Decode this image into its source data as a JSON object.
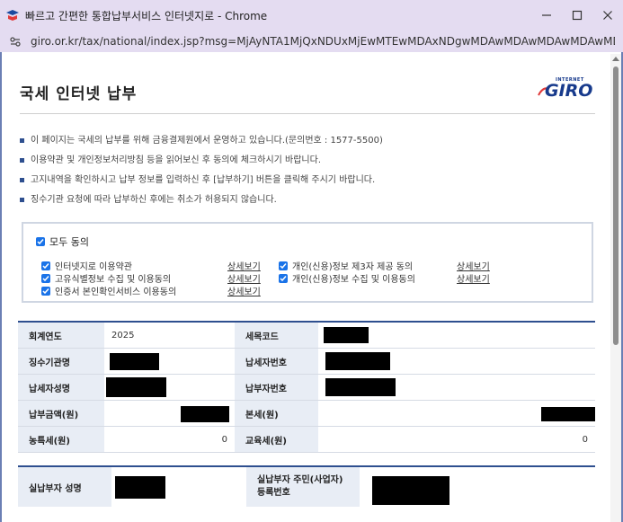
{
  "browser": {
    "title": "빠르고 간편한 통합납부서비스 인터넷지로 - Chrome",
    "url": "giro.or.kr/tax/national/index.jsp?msg=MjAyNTA1MjQxNDUxMjEwMTEwMDAxNDgwMDAwMDAwMDAwMDAwMDA..."
  },
  "page": {
    "title": "국세 인터넷 납부",
    "logo_small": "INTERNET",
    "logo_main": "GIRO"
  },
  "notes": [
    "이 페이지는 국세의 납부를 위해 금융결제원에서 운영하고 있습니다.(문의번호 : 1577-5500)",
    "이용약관 및 개인정보처리방침 등을 읽어보신 후 동의에 체크하시기 바랍니다.",
    "고지내역을 확인하시고 납부 정보를 입력하신 후 [납부하기] 버튼을 클릭해 주시기 바랍니다.",
    "징수기관 요청에 따라 납부하신 후에는 취소가 허용되지 않습니다."
  ],
  "agreement": {
    "all_label": "모두 동의",
    "items": [
      {
        "label": "인터넷지로 이용약관",
        "link": "상세보기"
      },
      {
        "label": "고유식별정보 수집 및 이용동의",
        "link": "상세보기"
      },
      {
        "label": "인증서 본인확인서비스 이용동의",
        "link": "상세보기"
      },
      {
        "label": "개인(신용)정보 제3자 제공 동의",
        "link": "상세보기"
      },
      {
        "label": "개인(신용)정보 수집 및 이용동의",
        "link": "상세보기"
      }
    ]
  },
  "tax_info": {
    "fiscal_year_label": "회계연도",
    "fiscal_year_value": "2025",
    "tax_code_label": "세목코드",
    "collector_label": "징수기관명",
    "taxpayer_no_label": "납세자번호",
    "taxpayer_name_label": "납세자성명",
    "payer_no_label": "납부자번호",
    "amount_label": "납부금액(원)",
    "main_tax_label": "본세(원)",
    "rural_tax_label": "농특세(원)",
    "rural_tax_value": "0",
    "edu_tax_label": "교육세(원)",
    "edu_tax_value": "0"
  },
  "payer_info": {
    "name_label": "실납부자 성명",
    "id_label_line1": "실납부자 주민(사업자)",
    "id_label_line2": "등록번호"
  },
  "colors": {
    "accent": "#2e4f8f",
    "checkbox": "#1a73e8",
    "header_bg": "#e8edf5",
    "titlebar": "#e4dcf1"
  }
}
